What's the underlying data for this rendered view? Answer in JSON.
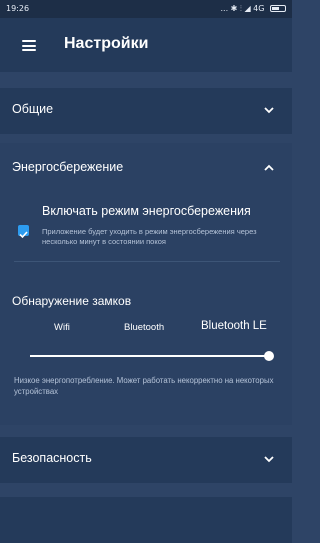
{
  "status_bar": {
    "time": "19:26",
    "icons_text": "... ✱ ⫶ ◢ 4G",
    "icons": [
      "dots-icon",
      "bluetooth-icon",
      "signal-icon",
      "4g-icon",
      "battery-icon"
    ]
  },
  "app_bar": {
    "menu_icon": "hamburger-menu-icon",
    "title": "Настройки"
  },
  "sections": {
    "general": {
      "label": "Общие",
      "expanded": false
    },
    "power": {
      "label": "Энергосбережение",
      "expanded": true
    },
    "security": {
      "label": "Безопасность",
      "expanded": false
    }
  },
  "power_saving": {
    "toggle_title": "Включать режим энергосбережения",
    "checked": true,
    "description": "Приложение будет уходить в режим энергосбережения через несколько минут в состоянии покоя"
  },
  "lock_detection": {
    "title": "Обнаружение замков",
    "modes": [
      "Wifi",
      "Bluetooth",
      "Bluetooth LE"
    ],
    "selected": "Bluetooth LE",
    "slider_position": 1.0,
    "note": "Низкое энергопотребление. Может работать некорректно на некоторых устройствах"
  },
  "colors": {
    "background": "#2e4466",
    "header": "#243a5a",
    "accent": "#2d9cf0",
    "muted_text": "#b5c3d8"
  }
}
